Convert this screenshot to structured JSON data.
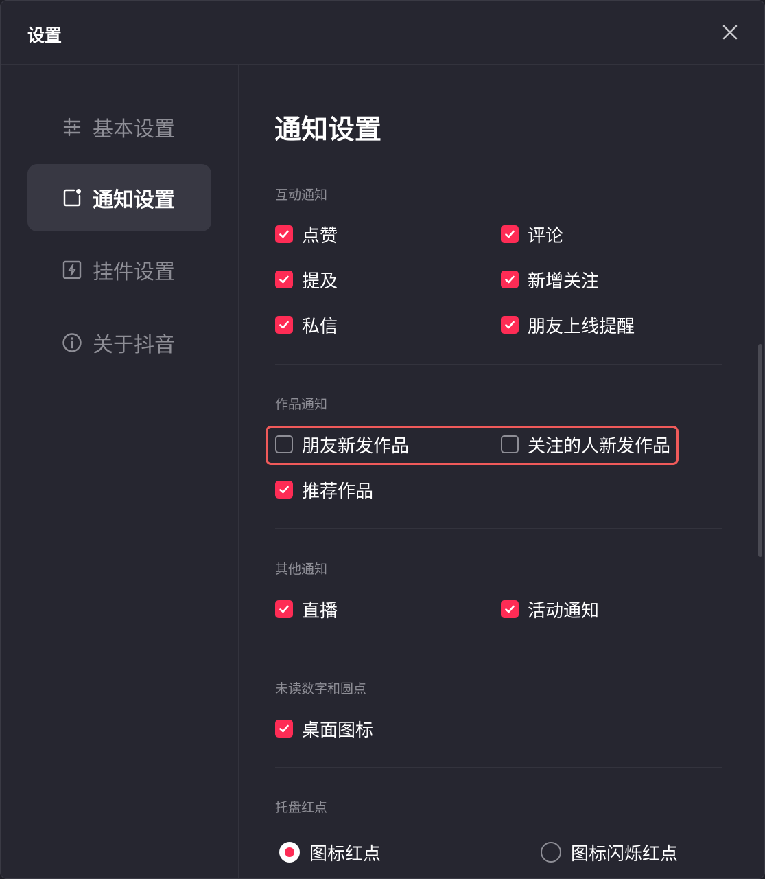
{
  "window": {
    "title": "设置"
  },
  "sidebar": {
    "items": [
      {
        "label": "基本设置",
        "icon": "sliders-icon",
        "active": false
      },
      {
        "label": "通知设置",
        "icon": "notification-icon",
        "active": true
      },
      {
        "label": "挂件设置",
        "icon": "widget-icon",
        "active": false
      },
      {
        "label": "关于抖音",
        "icon": "info-icon",
        "active": false
      }
    ]
  },
  "main": {
    "title": "通知设置",
    "sections": {
      "interaction": {
        "title": "互动通知",
        "options": [
          {
            "label": "点赞",
            "checked": true
          },
          {
            "label": "评论",
            "checked": true
          },
          {
            "label": "提及",
            "checked": true
          },
          {
            "label": "新增关注",
            "checked": true
          },
          {
            "label": "私信",
            "checked": true
          },
          {
            "label": "朋友上线提醒",
            "checked": true
          }
        ]
      },
      "works": {
        "title": "作品通知",
        "options": [
          {
            "label": "朋友新发作品",
            "checked": false
          },
          {
            "label": "关注的人新发作品",
            "checked": false
          },
          {
            "label": "推荐作品",
            "checked": true
          }
        ]
      },
      "other": {
        "title": "其他通知",
        "options": [
          {
            "label": "直播",
            "checked": true
          },
          {
            "label": "活动通知",
            "checked": true
          }
        ]
      },
      "unread": {
        "title": "未读数字和圆点",
        "options": [
          {
            "label": "桌面图标",
            "checked": true
          }
        ]
      },
      "tray": {
        "title": "托盘红点",
        "options": [
          {
            "label": "图标红点",
            "selected": true
          },
          {
            "label": "图标闪烁红点",
            "selected": false
          }
        ]
      }
    }
  },
  "colors": {
    "accent": "#fe2c55",
    "highlight": "#f05a5a",
    "background": "#262630"
  }
}
